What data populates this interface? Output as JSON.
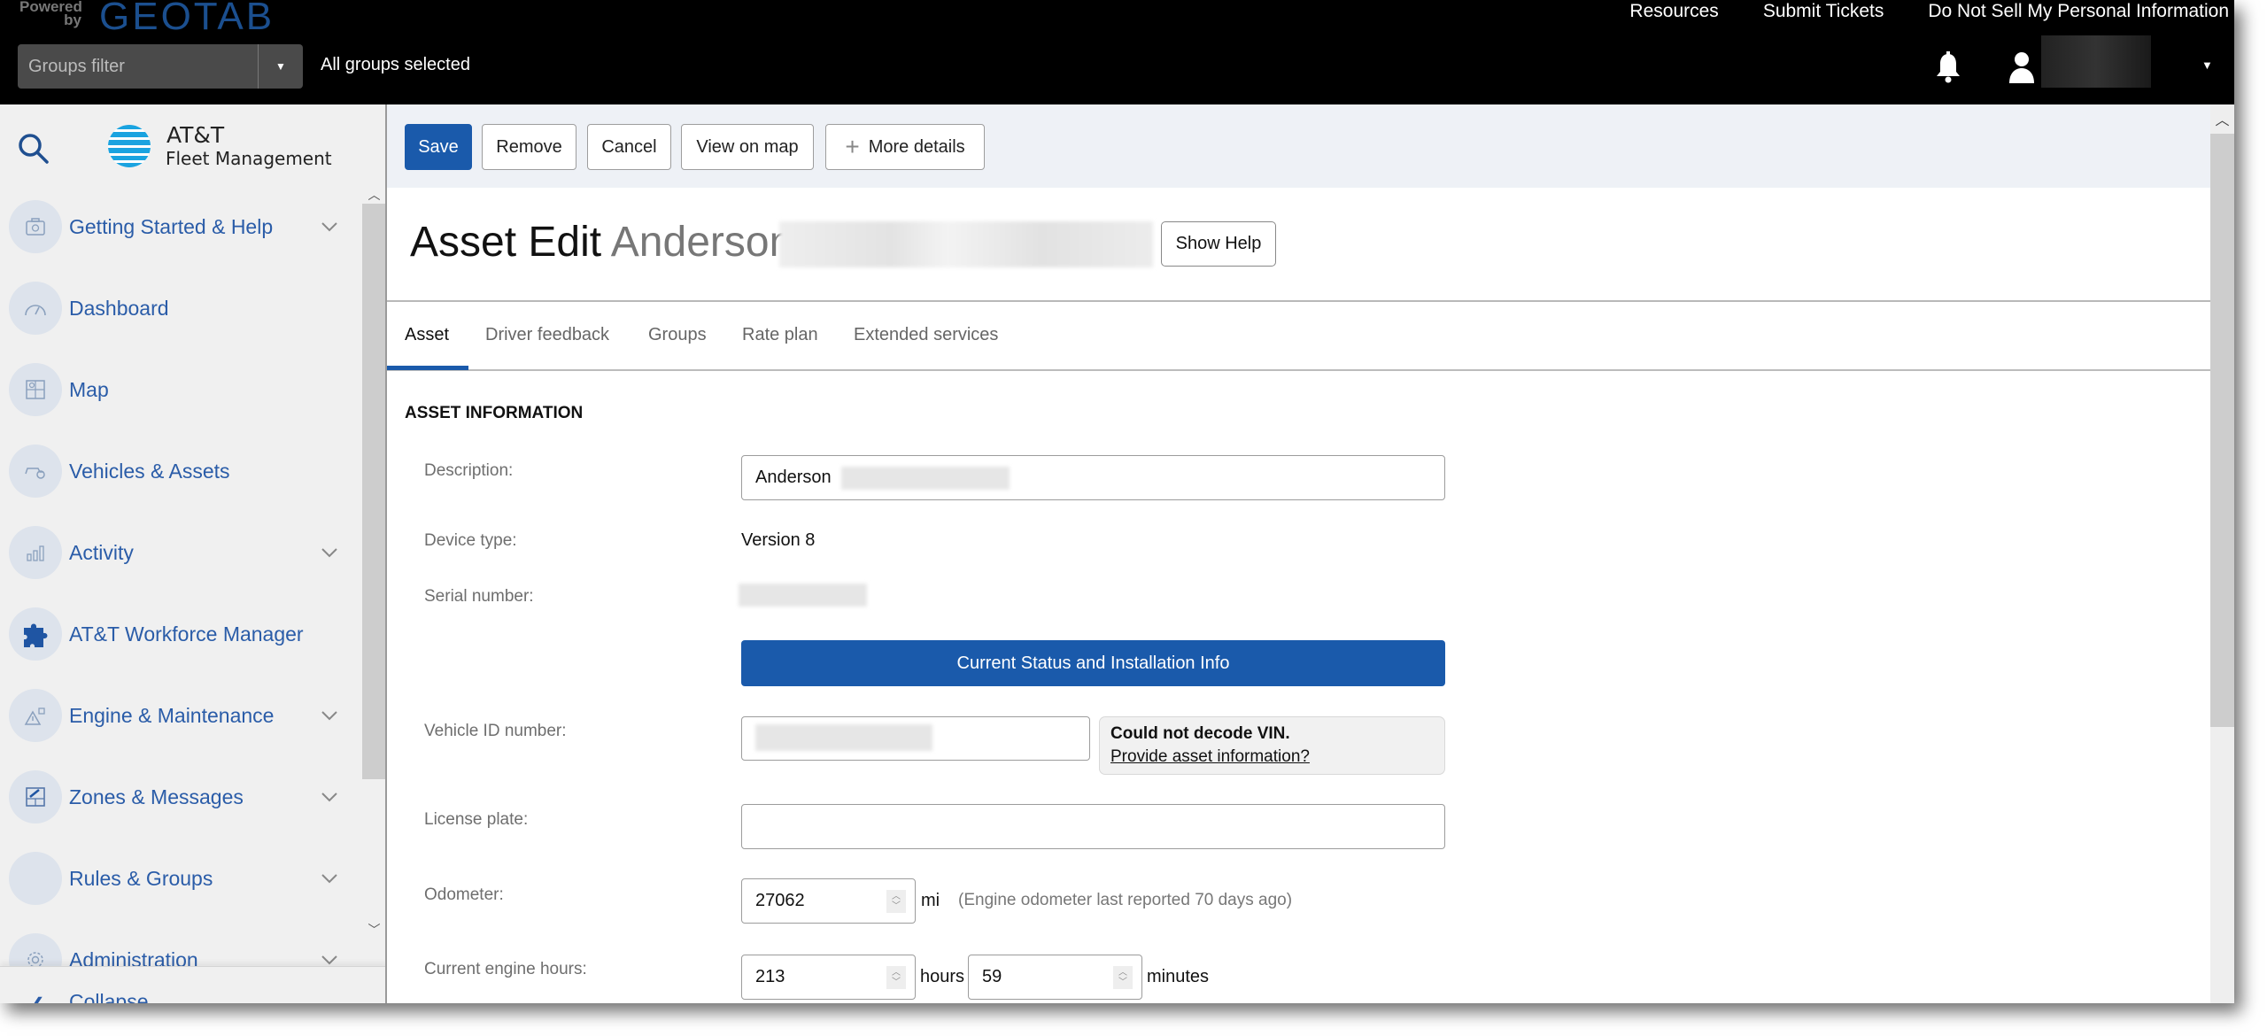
{
  "topbar": {
    "powered_by": "Powered by",
    "brand": "GEOTAB",
    "links": [
      "Resources",
      "Submit Tickets",
      "Do Not Sell My Personal Information"
    ],
    "groups_filter_placeholder": "Groups filter",
    "groups_status": "All groups selected",
    "user_menu_caret": "▼",
    "filter_caret": "▼"
  },
  "sidebar": {
    "brand_line1": "AT&T",
    "brand_line2": "Fleet Management",
    "items": [
      {
        "label": "Getting Started & Help",
        "icon": "first-aid-kit-icon",
        "expandable": true
      },
      {
        "label": "Dashboard",
        "icon": "gauge-icon",
        "expandable": false
      },
      {
        "label": "Map",
        "icon": "map-icon",
        "expandable": false
      },
      {
        "label": "Vehicles & Assets",
        "icon": "vehicle-icon",
        "expandable": false
      },
      {
        "label": "Activity",
        "icon": "bar-chart-icon",
        "expandable": true
      },
      {
        "label": "AT&T Workforce Manager",
        "icon": "puzzle-icon",
        "expandable": false
      },
      {
        "label": "Engine & Maintenance",
        "icon": "engine-warning-icon",
        "expandable": true
      },
      {
        "label": "Zones & Messages",
        "icon": "zone-edit-icon",
        "expandable": true
      },
      {
        "label": "Rules & Groups",
        "icon": "rules-icon",
        "expandable": true
      },
      {
        "label": "Administration",
        "icon": "gear-icon",
        "expandable": true
      }
    ],
    "footer_label": "Collapse"
  },
  "toolbar": {
    "save": "Save",
    "remove": "Remove",
    "cancel": "Cancel",
    "view_on_map": "View on map",
    "more_details": "More details"
  },
  "page": {
    "title": "Asset Edit",
    "asset_name": "Anderson",
    "show_help": "Show Help"
  },
  "tabs": [
    {
      "label": "Asset",
      "active": true
    },
    {
      "label": "Driver feedback",
      "active": false
    },
    {
      "label": "Groups",
      "active": false
    },
    {
      "label": "Rate plan",
      "active": false
    },
    {
      "label": "Extended services",
      "active": false
    }
  ],
  "form": {
    "section_title": "ASSET INFORMATION",
    "description_label": "Description:",
    "description_value": "Anderson",
    "device_type_label": "Device type:",
    "device_type_value": "Version 8",
    "serial_label": "Serial number:",
    "status_button": "Current Status and Installation Info",
    "vin_label": "Vehicle ID number:",
    "vin_message": "Could not decode VIN.",
    "vin_link": "Provide asset information?",
    "license_label": "License plate:",
    "license_value": "",
    "odometer_label": "Odometer:",
    "odometer_value": "27062",
    "odometer_unit": "mi",
    "odometer_hint": "(Engine odometer last reported 70 days ago)",
    "engine_hours_label": "Current engine hours:",
    "engine_hours_value": "213",
    "engine_hours_unit": "hours",
    "engine_minutes_value": "59",
    "engine_minutes_unit": "minutes"
  },
  "colors": {
    "brand_blue": "#1a5aab",
    "sidebar_text": "#2a5ca8",
    "topbar": "#000000"
  }
}
